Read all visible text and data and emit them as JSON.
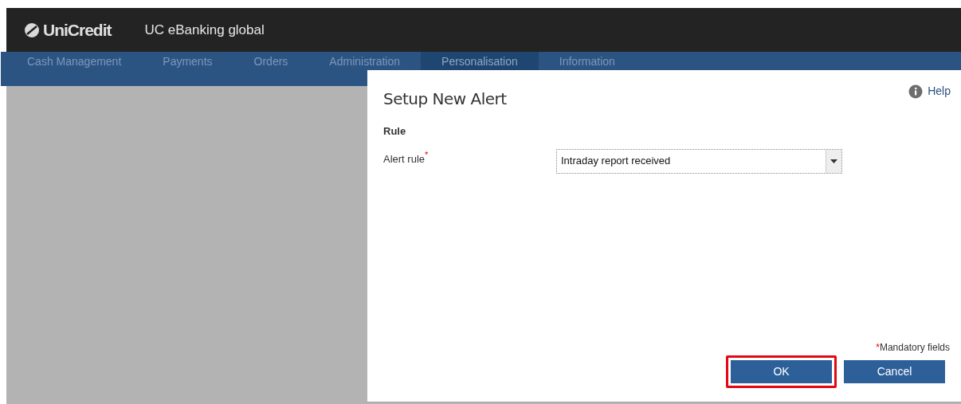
{
  "header": {
    "brand": "UniCredit",
    "app_title": "UC eBanking global"
  },
  "nav": [
    {
      "label": "Cash Management",
      "selected": false
    },
    {
      "label": "Payments",
      "selected": false
    },
    {
      "label": "Orders",
      "selected": false
    },
    {
      "label": "Administration",
      "selected": false
    },
    {
      "label": "Personalisation",
      "selected": true
    },
    {
      "label": "Information",
      "selected": false
    }
  ],
  "dialog": {
    "title": "Setup New Alert",
    "help": "Help",
    "section": "Rule",
    "fields": [
      {
        "label": "Alert rule",
        "required_mark": "*",
        "value": "Intraday report received"
      }
    ],
    "mandatory_note": {
      "mark": "*",
      "text": "Mandatory fields"
    },
    "buttons": [
      {
        "label": "OK",
        "highlighted": true
      },
      {
        "label": "Cancel",
        "highlighted": false
      }
    ]
  }
}
